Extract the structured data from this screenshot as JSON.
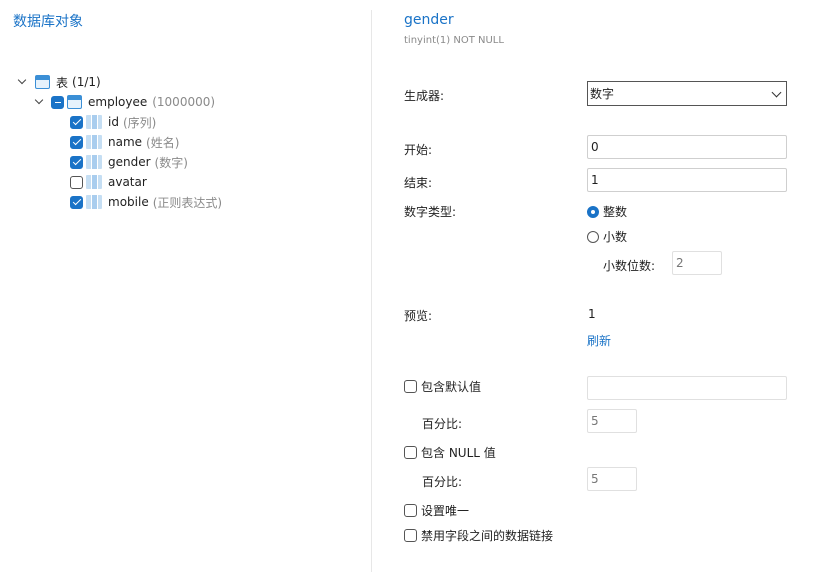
{
  "left": {
    "title": "数据库对象"
  },
  "tree": {
    "root": {
      "label": "表",
      "count": "(1/1)"
    },
    "table": {
      "name": "employee",
      "count": "(1000000)"
    },
    "columns": [
      {
        "name": "id",
        "type": "(序列)",
        "checked": true
      },
      {
        "name": "name",
        "type": "(姓名)",
        "checked": true
      },
      {
        "name": "gender",
        "type": "(数字)",
        "checked": true
      },
      {
        "name": "avatar",
        "type": "",
        "checked": false
      },
      {
        "name": "mobile",
        "type": "(正则表达式)",
        "checked": true
      }
    ]
  },
  "field": {
    "name": "gender",
    "type": "tinyint(1) NOT NULL"
  },
  "form": {
    "generator_label": "生成器:",
    "generator_value": "数字",
    "start_label": "开始:",
    "start_value": "0",
    "end_label": "结束:",
    "end_value": "1",
    "numtype_label": "数字类型:",
    "integer_label": "整数",
    "decimal_label": "小数",
    "decimal_places_label": "小数位数:",
    "decimal_places_value": "2",
    "preview_label": "预览:",
    "preview_value": "1",
    "refresh_label": "刷新",
    "include_default_label": "包含默认值",
    "default_value": "",
    "percent_label_1": "百分比:",
    "percent_value_1": "5",
    "include_null_label": "包含 NULL 值",
    "percent_label_2": "百分比:",
    "percent_value_2": "5",
    "unique_label": "设置唯一",
    "disable_link_label": "禁用字段之间的数据链接"
  },
  "colors": {
    "accent": "#1a73c7",
    "muted": "#8a8a8a"
  }
}
